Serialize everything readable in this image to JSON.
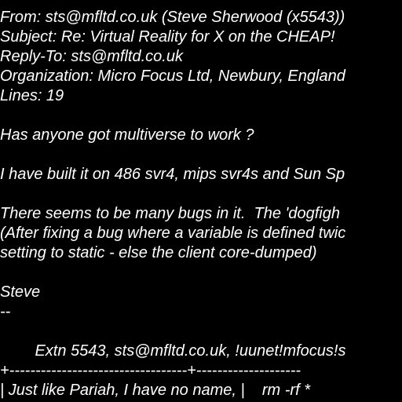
{
  "email": {
    "headers": {
      "from": "From: sts@mfltd.co.uk (Steve Sherwood (x5543))",
      "subject": "Subject: Re: Virtual Reality for X on the CHEAP!",
      "reply_to": "Reply-To: sts@mfltd.co.uk",
      "organization": "Organization: Micro Focus Ltd, Newbury, England",
      "lines": "Lines: 19"
    },
    "body": {
      "line1": "Has anyone got multiverse to work ?",
      "line2": "I have built it on 486 svr4, mips svr4s and Sun Sp",
      "line3": "There seems to be many bugs in it.  The 'dogfigh",
      "line4": "(After fixing a bug where a variable is defined twic",
      "line5": "setting to static - else the client core-dumped)",
      "line6": "Steve",
      "line7": "--"
    },
    "signature": {
      "line1": "        Extn 5543, sts@mfltd.co.uk, !uunet!mfocus!s",
      "line2": "+----------------------------------+--------------------",
      "line3": "| Just like Pariah, I have no name, |    rm -rf *"
    }
  }
}
